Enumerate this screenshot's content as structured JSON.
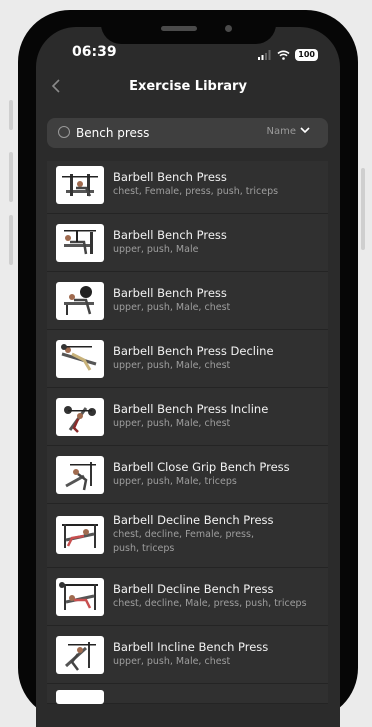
{
  "status": {
    "time": "06:39",
    "battery": "100"
  },
  "header": {
    "title": "Exercise Library"
  },
  "search": {
    "value": "Bench press",
    "sort_label": "Name"
  },
  "exercises": [
    {
      "name": "Barbell Bench Press",
      "tags": [
        "chest, Female, press, push, triceps"
      ]
    },
    {
      "name": "Barbell Bench Press",
      "tags": [
        "upper, push, Male"
      ]
    },
    {
      "name": "Barbell Bench Press",
      "tags": [
        "upper, push, Male, chest"
      ]
    },
    {
      "name": "Barbell Bench Press Decline",
      "tags": [
        "upper, push, Male, chest"
      ]
    },
    {
      "name": "Barbell Bench Press Incline",
      "tags": [
        "upper, push, Male, chest"
      ]
    },
    {
      "name": "Barbell Close Grip Bench Press",
      "tags": [
        "upper, push, Male, triceps"
      ]
    },
    {
      "name": "Barbell Decline Bench Press",
      "tags": [
        "chest, decline, Female, press,",
        "push, triceps"
      ]
    },
    {
      "name": "Barbell Decline Bench Press",
      "tags": [
        "chest, decline, Male, press, push, triceps"
      ]
    },
    {
      "name": "Barbell Incline Bench Press",
      "tags": [
        "upper, push, Male, chest"
      ]
    }
  ]
}
